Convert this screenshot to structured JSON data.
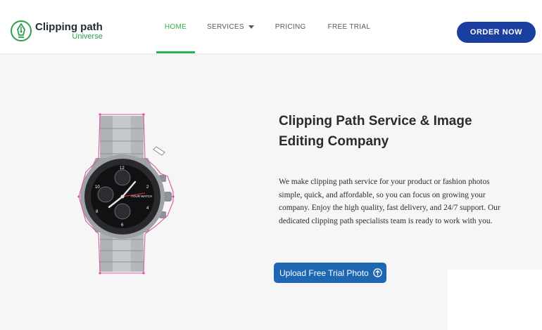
{
  "logo": {
    "line1": "Clipping path",
    "line2": "Universe"
  },
  "nav": {
    "items": [
      {
        "label": "HOME",
        "active": true
      },
      {
        "label": "SERVICES",
        "has_dropdown": true
      },
      {
        "label": "PRICING"
      },
      {
        "label": "FREE TRIAL"
      }
    ]
  },
  "header": {
    "order_button": "ORDER NOW"
  },
  "hero": {
    "headline_line1": "Clipping Path Service & Image",
    "headline_line2": "Editing Company",
    "description": "We make clipping path service for your product or fashion photos simple, quick, and affordable, so you can focus on growing your company. Enjoy the high quality, fast delivery, and 24/7 support. Our dedicated clipping path specialists team is ready to work with you.",
    "upload_button": "Upload Free Trial Photo",
    "watch_label": "YOUR WATCH",
    "watch_numbers": [
      "2",
      "4",
      "6",
      "8",
      "10",
      "12"
    ]
  },
  "colors": {
    "accent_green": "#2fb24a",
    "order_blue": "#1a3fa0",
    "upload_blue": "#1d67b3",
    "path_pink": "#e0559a"
  },
  "icons": [
    "logo-pen-icon",
    "chevron-down-icon",
    "arrow-up-circle-icon"
  ]
}
